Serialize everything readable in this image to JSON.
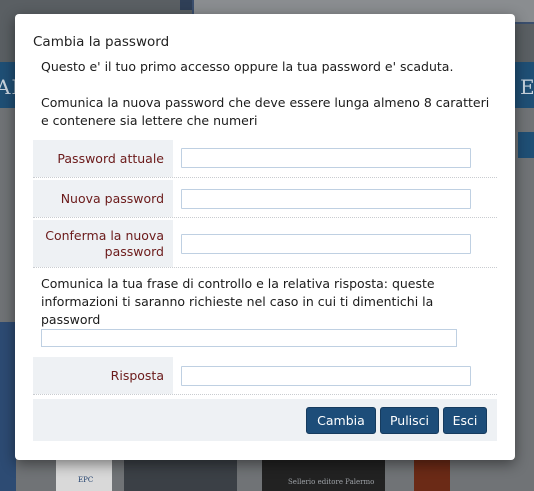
{
  "background": {
    "nav_left_text": "AN",
    "nav_right_text": "E",
    "book_publisher_text": "Sellerio editore Palermo",
    "book_epc_text": "EPC"
  },
  "dialog": {
    "title": "Cambia la password",
    "intro_line": "Questo e' il tuo primo accesso oppure la tua password e' scaduta.",
    "instructions": "Comunica la nuova password che deve essere lunga almeno 8 caratteri e contenere sia lettere che numeri",
    "fields": {
      "current_password": {
        "label": "Password attuale",
        "value": ""
      },
      "new_password": {
        "label": "Nuova password",
        "value": ""
      },
      "confirm_password": {
        "label": "Conferma la nuova password",
        "value": ""
      }
    },
    "security_instructions": "Comunica la tua frase di controllo e la relativa risposta: queste informazioni ti saranno richieste nel caso in cui ti dimentichi la password",
    "security_phrase": {
      "value": ""
    },
    "answer": {
      "label": "Risposta",
      "value": ""
    },
    "buttons": {
      "submit": "Cambia",
      "clear": "Pulisci",
      "exit": "Esci"
    }
  },
  "colors": {
    "button_bg": "#1d4d79",
    "label_text": "#6b1a1a",
    "label_cell_bg": "#eef1f4",
    "input_border": "#bfd0e2"
  }
}
